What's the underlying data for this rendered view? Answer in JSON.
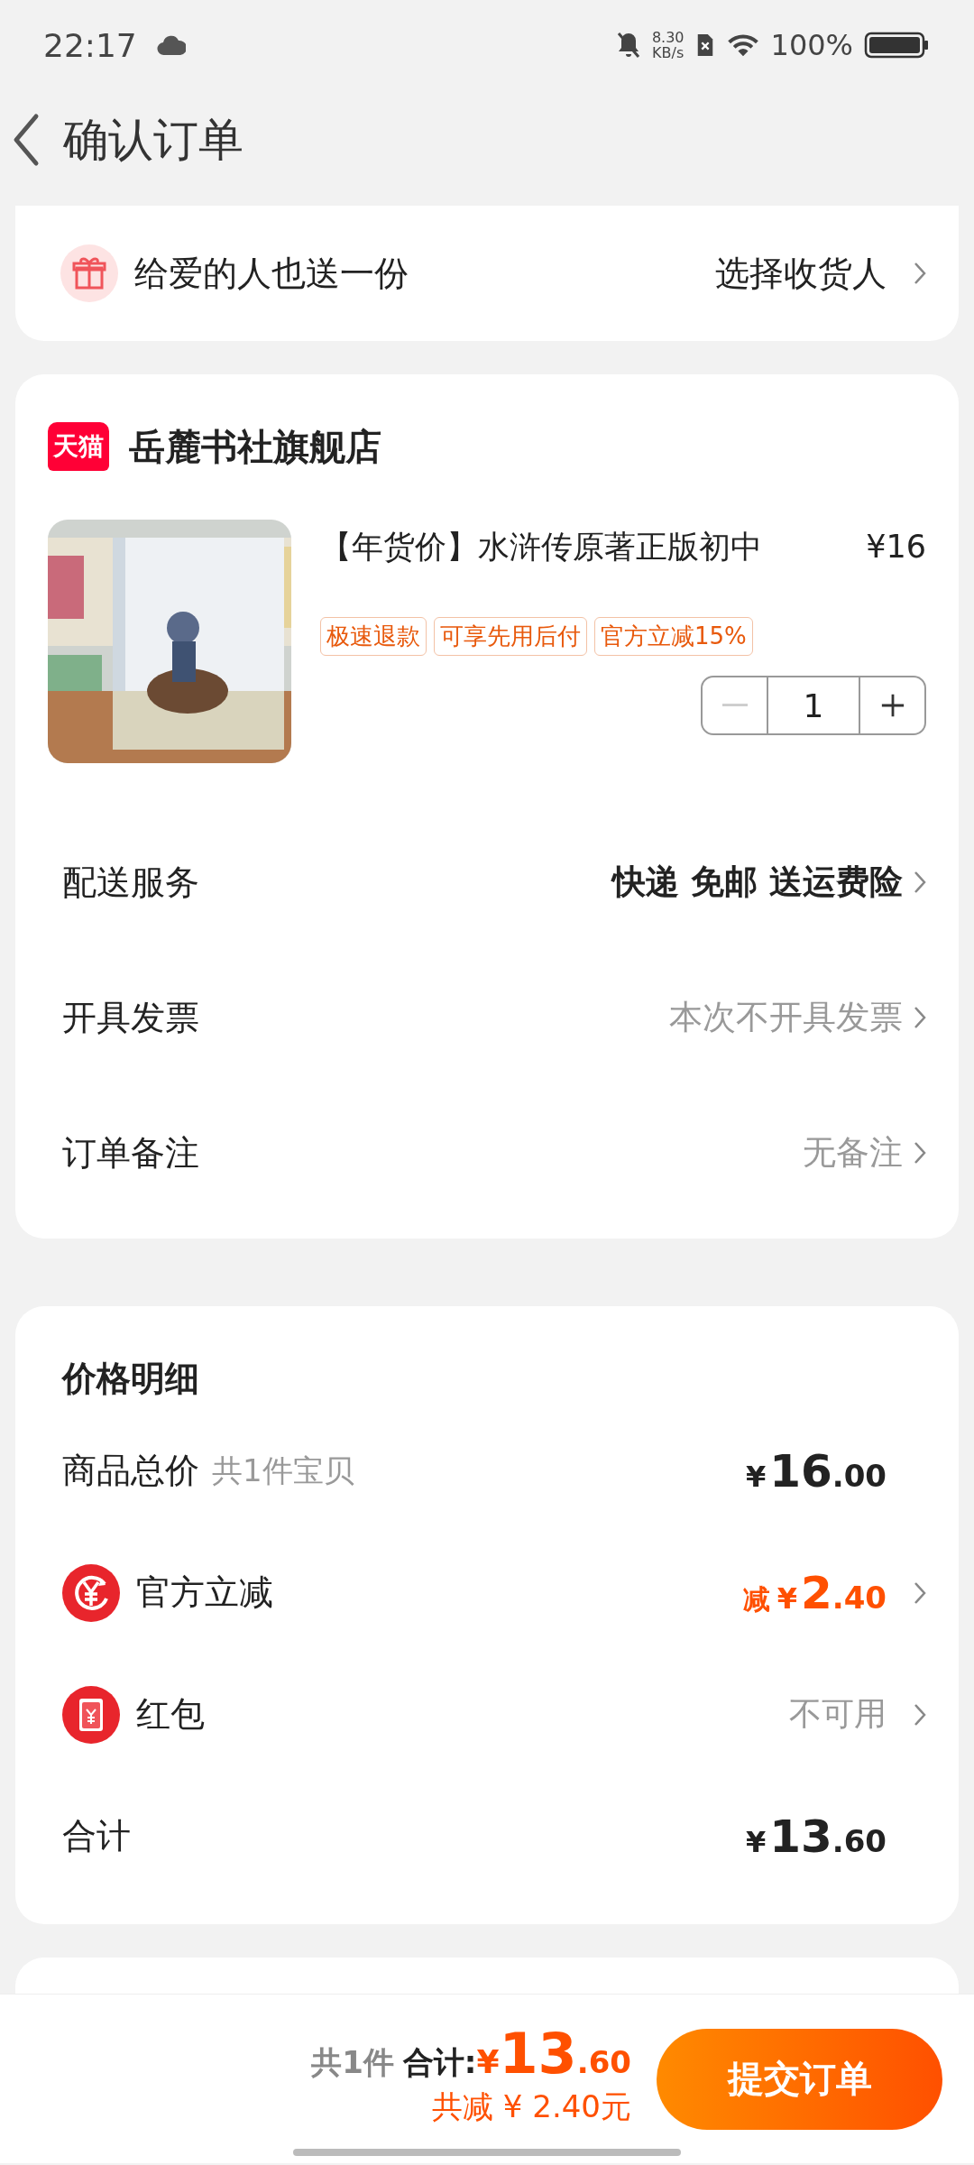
{
  "status_bar": {
    "time": "22:17",
    "net_speed_value": "8.30",
    "net_speed_unit": "KB/s",
    "battery": "100%"
  },
  "header": {
    "title": "确认订单"
  },
  "gift": {
    "label": "给爱的人也送一份",
    "action": "选择收货人"
  },
  "store": {
    "badge": "天猫",
    "name": "岳麓书社旗舰店"
  },
  "product": {
    "title": "【年货价】水浒传原著正版初中",
    "price": "¥16",
    "tags": [
      "极速退款",
      "可享先用后付",
      "官方立减15%"
    ],
    "quantity": "1",
    "minus_disabled": true
  },
  "options": [
    {
      "label": "配送服务",
      "value": "快递 免邮 送运费险",
      "kind": "emphasized"
    },
    {
      "label": "开具发票",
      "value": "本次不开具发票",
      "kind": "muted"
    },
    {
      "label": "订单备注",
      "value": "无备注",
      "kind": "muted"
    }
  ],
  "price_detail": {
    "title": "价格明细",
    "rows": [
      {
        "kind": "subtotal",
        "label": "商品总价",
        "note": "共1件宝贝",
        "amount": {
          "currency": "¥",
          "integer": "16",
          "decimal": ".00"
        }
      },
      {
        "kind": "discount",
        "label": "官方立减",
        "amount": {
          "prefix": "减",
          "currency": "¥",
          "integer": "2",
          "decimal": ".40"
        },
        "chevron": true
      },
      {
        "kind": "coupon",
        "label": "红包",
        "text": "不可用",
        "chevron": true
      },
      {
        "kind": "total",
        "label": "合计",
        "amount": {
          "currency": "¥",
          "integer": "13",
          "decimal": ".60"
        }
      }
    ]
  },
  "bottom_bar": {
    "count": "共1件",
    "total_label": "合计:",
    "total": {
      "currency": "¥",
      "integer": "13",
      "decimal": ".60"
    },
    "savings": "共减 ¥ 2.40元",
    "submit": "提交订单"
  }
}
